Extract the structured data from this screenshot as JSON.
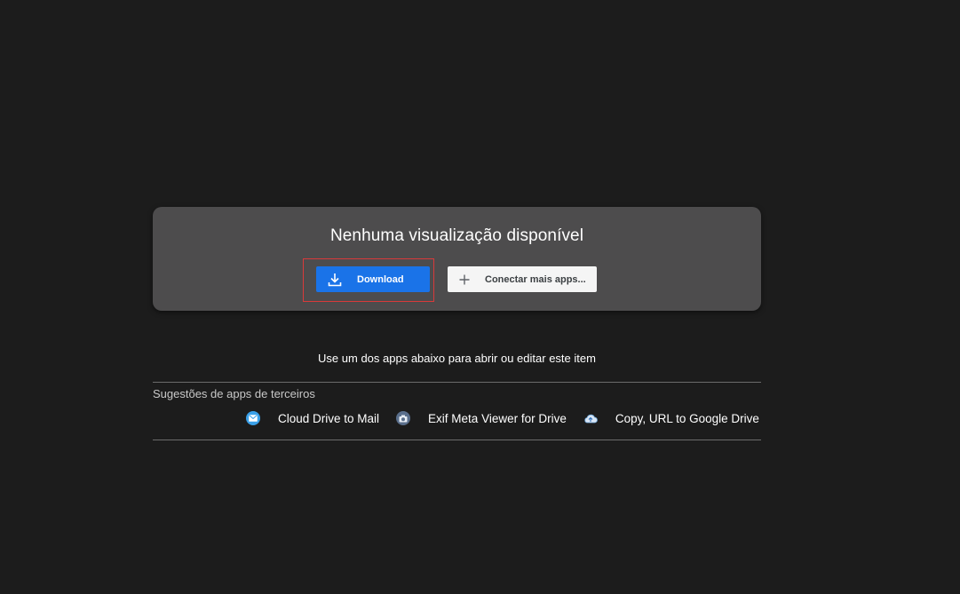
{
  "preview": {
    "title": "Nenhuma visualização disponível",
    "download_label": "Download",
    "connect_label": "Conectar mais apps..."
  },
  "apps_section": {
    "prompt": "Use um dos apps abaixo para abrir ou editar este item",
    "heading": "Sugestões de apps de terceiros",
    "apps": [
      {
        "name": "Cloud Drive to Mail",
        "icon": "mail-icon",
        "color": "#3aa0e8"
      },
      {
        "name": "Exif Meta Viewer for Drive",
        "icon": "camera-icon",
        "color": "#5a6f8c"
      },
      {
        "name": "Copy, URL to Google Drive",
        "icon": "cloud-upload-icon",
        "color": "#6fa8dc"
      }
    ]
  },
  "colors": {
    "background": "#1c1c1c",
    "card": "#4d4c4d",
    "primary_button": "#1a73e8",
    "highlight_border": "#d93a3a"
  }
}
